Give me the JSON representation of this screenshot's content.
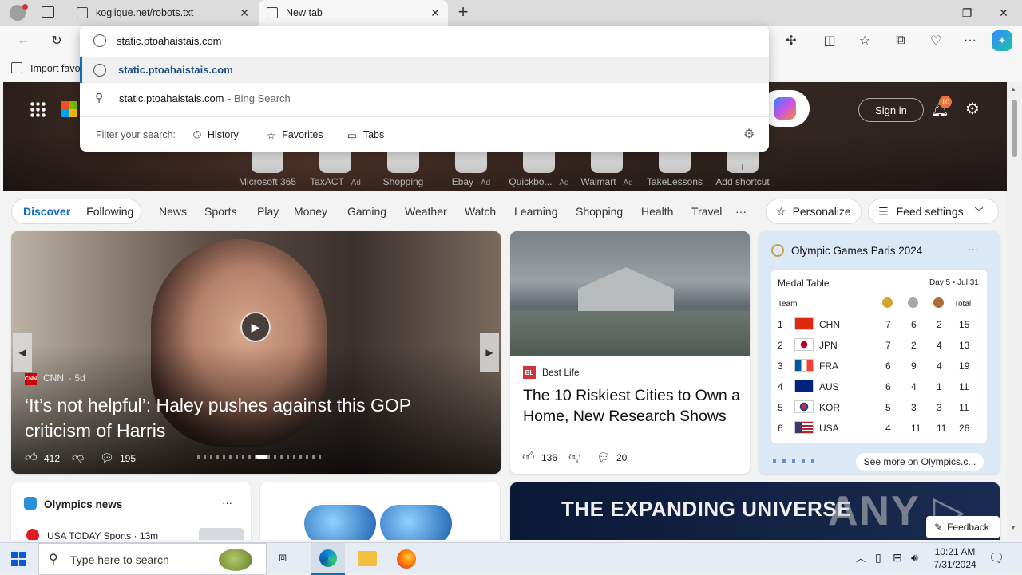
{
  "tabs": [
    {
      "title": "koglique.net/robots.txt"
    },
    {
      "title": "New tab"
    }
  ],
  "omnibox": {
    "input_value": "static.ptoahaistais.com",
    "suggestions": [
      {
        "text": "static.ptoahaistais.com",
        "suffix": ""
      },
      {
        "text": "static.ptoahaistais.com",
        "suffix": " - Bing Search"
      }
    ],
    "filter_label": "Filter your search:",
    "filters": [
      "History",
      "Favorites",
      "Tabs"
    ]
  },
  "favorites_bar": {
    "import_label": "Import favo"
  },
  "top_right": {
    "signin": "Sign in",
    "notif_count": "10"
  },
  "shortcuts": [
    {
      "label": "Microsoft 365",
      "ad": ""
    },
    {
      "label": "TaxACT",
      "ad": "· Ad"
    },
    {
      "label": "Shopping",
      "ad": ""
    },
    {
      "label": "Ebay",
      "ad": "· Ad"
    },
    {
      "label": "Quickbo...",
      "ad": "· Ad"
    },
    {
      "label": "Walmart",
      "ad": "· Ad"
    },
    {
      "label": "TakeLessons",
      "ad": ""
    },
    {
      "label": "Add shortcut",
      "ad": ""
    }
  ],
  "nav": {
    "discover": "Discover",
    "following": "Following",
    "items": [
      "News",
      "Sports",
      "Play",
      "Money",
      "Gaming",
      "Weather",
      "Watch",
      "Learning",
      "Shopping",
      "Health",
      "Travel"
    ],
    "more": "···",
    "personalize": "Personalize",
    "feed_settings": "Feed settings"
  },
  "main_story": {
    "source": "CNN",
    "age": "· 5d",
    "headline": "‘It’s not helpful’: Haley pushes against this GOP criticism of Harris",
    "likes": "412",
    "comments": "195"
  },
  "story2": {
    "source": "Best Life",
    "headline": "The 10 Riskiest Cities to Own a Home, New Research Shows",
    "likes": "136",
    "comments": "20"
  },
  "olympics": {
    "title": "Olympic Games Paris 2024",
    "medal_table": "Medal Table",
    "day": "Day 5 • Jul 31",
    "team_header": "Team",
    "total_header": "Total",
    "rows": [
      {
        "rank": "1",
        "code": "CHN",
        "g": "7",
        "s": "6",
        "b": "2",
        "t": "15"
      },
      {
        "rank": "2",
        "code": "JPN",
        "g": "7",
        "s": "2",
        "b": "4",
        "t": "13"
      },
      {
        "rank": "3",
        "code": "FRA",
        "g": "6",
        "s": "9",
        "b": "4",
        "t": "19"
      },
      {
        "rank": "4",
        "code": "AUS",
        "g": "6",
        "s": "4",
        "b": "1",
        "t": "11"
      },
      {
        "rank": "5",
        "code": "KOR",
        "g": "5",
        "s": "3",
        "b": "3",
        "t": "11"
      },
      {
        "rank": "6",
        "code": "USA",
        "g": "4",
        "s": "11",
        "b": "11",
        "t": "26"
      }
    ],
    "see_more": "See more on Olympics.c..."
  },
  "bottom": {
    "olympics_news": "Olympics news",
    "usa_today": "USA TODAY Sports · 13m",
    "universe": "THE EXPANDING UNIVERSE",
    "feedback": "Feedback"
  },
  "taskbar": {
    "search_placeholder": "Type here to search",
    "time": "10:21 AM",
    "date": "7/31/2024"
  },
  "colors": {
    "accent": "#0f6cbd",
    "bing_blue": "#1a5fb4"
  }
}
